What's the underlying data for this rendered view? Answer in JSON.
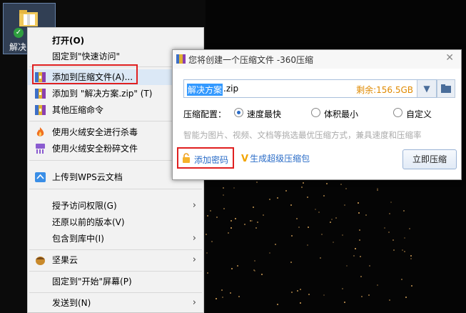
{
  "desktop": {
    "icon_label": "解决"
  },
  "context_menu": {
    "items": [
      {
        "label": "打开(O)",
        "bold": true
      },
      {
        "label": "固定到\"快速访问\""
      },
      {
        "label": "添加到压缩文件(A)...",
        "icon": "zip-archive-icon"
      },
      {
        "label": "添加到 \"解决方案.zip\" (T)",
        "icon": "zip-archive-icon"
      },
      {
        "label": "其他压缩命令",
        "icon": "zip-archive-icon"
      },
      {
        "label": "使用火绒安全进行杀毒",
        "icon": "huorong-flame-icon"
      },
      {
        "label": "使用火绒安全粉碎文件",
        "icon": "shredder-icon"
      },
      {
        "label": "上传到WPS云文档",
        "icon": "wps-cloud-icon"
      },
      {
        "label": "授予访问权限(G)",
        "arrow": "›"
      },
      {
        "label": "还原以前的版本(V)"
      },
      {
        "label": "包含到库中(I)",
        "arrow": "›"
      },
      {
        "label": "坚果云",
        "icon": "nutstore-icon",
        "arrow": "›"
      },
      {
        "label": "固定到\"开始\"屏幕(P)"
      },
      {
        "label": "发送到(N)",
        "arrow": "›"
      }
    ]
  },
  "dialog": {
    "title": "您将创建一个压缩文件 -360压缩",
    "close": "✕",
    "filename_selected": "解决方案",
    "filename_ext": ".zip",
    "free_space": "剩余:156.5GB",
    "dropdown_arrow": "▼",
    "config_label": "压缩配置：",
    "options": [
      "速度最快",
      "体积最小",
      "自定义"
    ],
    "selected_option": "速度最快",
    "hint": "智能为图片、视频、文档等挑选最优压缩方式，兼具速度和压缩率",
    "add_password": "添加密码",
    "sfx_mark": "V",
    "sfx_label": "生成超级压缩包",
    "start_button": "立即压缩"
  },
  "colors": {
    "accent_blue": "#2a6cc7",
    "highlight_red": "#e02020",
    "free_space_orange": "#e08a00",
    "selection_blue": "#3399ff"
  }
}
